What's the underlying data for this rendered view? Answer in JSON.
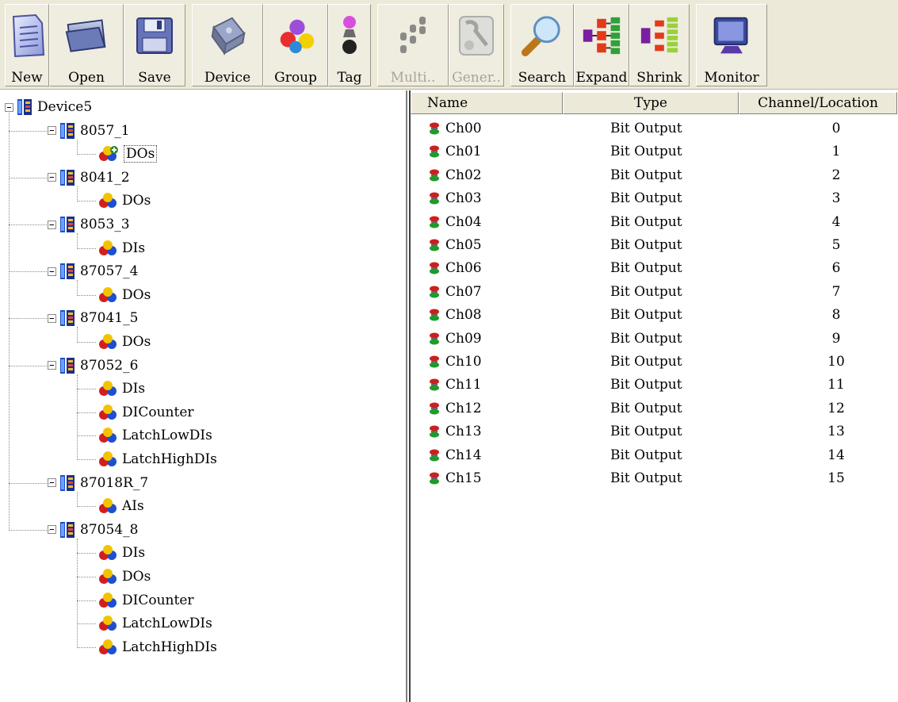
{
  "toolbar": {
    "buttons": [
      {
        "id": "new",
        "label": "New",
        "icon": "new-document-icon",
        "enabled": true
      },
      {
        "id": "open",
        "label": "Open",
        "icon": "open-folder-icon",
        "enabled": true
      },
      {
        "id": "save",
        "label": "Save",
        "icon": "floppy-disk-icon",
        "enabled": true
      },
      {
        "id": "device",
        "label": "Device",
        "icon": "device-module-icon",
        "enabled": true
      },
      {
        "id": "group",
        "label": "Group",
        "icon": "group-icon",
        "enabled": true
      },
      {
        "id": "tag",
        "label": "Tag",
        "icon": "tag-icon",
        "enabled": true
      },
      {
        "id": "multi",
        "label": "Multi..",
        "icon": "multi-tag-icon",
        "enabled": false
      },
      {
        "id": "gener",
        "label": "Gener..",
        "icon": "generator-icon",
        "enabled": false
      },
      {
        "id": "search",
        "label": "Search",
        "icon": "magnifier-icon",
        "enabled": true
      },
      {
        "id": "expand",
        "label": "Expand",
        "icon": "expand-tree-icon",
        "enabled": true
      },
      {
        "id": "shrink",
        "label": "Shrink",
        "icon": "shrink-tree-icon",
        "enabled": true
      },
      {
        "id": "monitor",
        "label": "Monitor",
        "icon": "monitor-icon",
        "enabled": true
      }
    ]
  },
  "tree": {
    "root": "Device5",
    "devices": [
      {
        "name": "8057_1",
        "groups": [
          "DOs"
        ]
      },
      {
        "name": "8041_2",
        "groups": [
          "DOs"
        ]
      },
      {
        "name": "8053_3",
        "groups": [
          "DIs"
        ]
      },
      {
        "name": "87057_4",
        "groups": [
          "DOs"
        ]
      },
      {
        "name": "87041_5",
        "groups": [
          "DOs"
        ]
      },
      {
        "name": "87052_6",
        "groups": [
          "DIs",
          "DICounter",
          "LatchLowDIs",
          "LatchHighDIs"
        ]
      },
      {
        "name": "87018R_7",
        "groups": [
          "AIs"
        ]
      },
      {
        "name": "87054_8",
        "groups": [
          "DIs",
          "DOs",
          "DICounter",
          "LatchLowDIs",
          "LatchHighDIs"
        ]
      }
    ]
  },
  "list": {
    "columns": {
      "name": "Name",
      "type": "Type",
      "channel": "Channel/Location"
    },
    "rows": [
      {
        "name": "Ch00",
        "type": "Bit Output",
        "channel": "0"
      },
      {
        "name": "Ch01",
        "type": "Bit Output",
        "channel": "1"
      },
      {
        "name": "Ch02",
        "type": "Bit Output",
        "channel": "2"
      },
      {
        "name": "Ch03",
        "type": "Bit Output",
        "channel": "3"
      },
      {
        "name": "Ch04",
        "type": "Bit Output",
        "channel": "4"
      },
      {
        "name": "Ch05",
        "type": "Bit Output",
        "channel": "5"
      },
      {
        "name": "Ch06",
        "type": "Bit Output",
        "channel": "6"
      },
      {
        "name": "Ch07",
        "type": "Bit Output",
        "channel": "7"
      },
      {
        "name": "Ch08",
        "type": "Bit Output",
        "channel": "8"
      },
      {
        "name": "Ch09",
        "type": "Bit Output",
        "channel": "9"
      },
      {
        "name": "Ch10",
        "type": "Bit Output",
        "channel": "10"
      },
      {
        "name": "Ch11",
        "type": "Bit Output",
        "channel": "11"
      },
      {
        "name": "Ch12",
        "type": "Bit Output",
        "channel": "12"
      },
      {
        "name": "Ch13",
        "type": "Bit Output",
        "channel": "13"
      },
      {
        "name": "Ch14",
        "type": "Bit Output",
        "channel": "14"
      },
      {
        "name": "Ch15",
        "type": "Bit Output",
        "channel": "15"
      }
    ]
  },
  "colors": {
    "toolbar_bg": "#ece9d8",
    "disabled_text": "#a7a59a",
    "tag_red": "#cc1f1f",
    "tag_green": "#1f9a2c"
  }
}
